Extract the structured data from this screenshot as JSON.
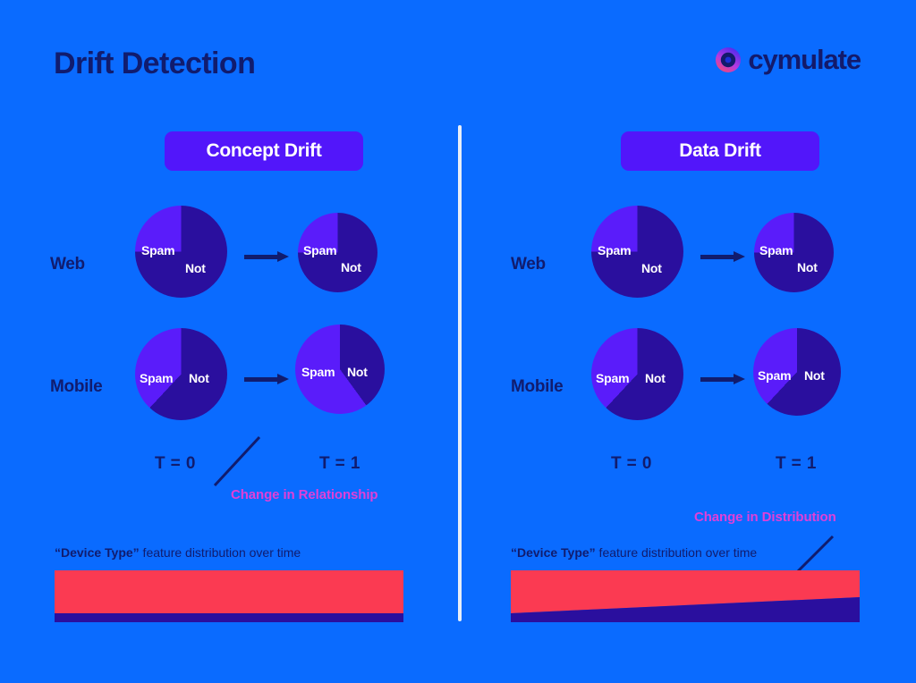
{
  "header": {
    "title": "Drift Detection",
    "logo_text": "cymulate",
    "logo_icon": "cymulate-ring-icon"
  },
  "colors": {
    "background": "#0a6bff",
    "navy": "#111c6e",
    "pill": "#5216fa",
    "pie_spam": "#5a1cfa",
    "pie_not": "#2a0f9e",
    "annotation": "#e040d8",
    "bar_top": "#fb3a52",
    "bar_bottom": "#2a0f9e",
    "divider": "#e8eef8"
  },
  "panels": [
    {
      "id": "concept-drift",
      "pill_label": "Concept Drift",
      "rows": [
        {
          "label": "Web",
          "pies": [
            {
              "t": "T = 0",
              "spam_pct": 25,
              "not_pct": 75,
              "spam_label": "Spam",
              "not_label": "Not"
            },
            {
              "t": "T = 1",
              "spam_pct": 25,
              "not_pct": 75,
              "spam_label": "Spam",
              "not_label": "Not"
            }
          ]
        },
        {
          "label": "Mobile",
          "pies": [
            {
              "t": "T = 0",
              "spam_pct": 38,
              "not_pct": 62,
              "spam_label": "Spam",
              "not_label": "Not"
            },
            {
              "t": "T = 1",
              "spam_pct": 60,
              "not_pct": 40,
              "spam_label": "Spam",
              "not_label": "Not"
            }
          ]
        }
      ],
      "annotation": "Change in Relationship",
      "dist_caption_quoted": "“Device Type”",
      "dist_caption_rest": " feature distribution over time",
      "dist_bar": {
        "type": "stable",
        "bottom_pct_start": 15,
        "bottom_pct_end": 15
      }
    },
    {
      "id": "data-drift",
      "pill_label": "Data Drift",
      "rows": [
        {
          "label": "Web",
          "pies": [
            {
              "t": "T = 0",
              "spam_pct": 25,
              "not_pct": 75,
              "spam_label": "Spam",
              "not_label": "Not"
            },
            {
              "t": "T = 1",
              "spam_pct": 25,
              "not_pct": 75,
              "spam_label": "Spam",
              "not_label": "Not"
            }
          ]
        },
        {
          "label": "Mobile",
          "pies": [
            {
              "t": "T = 0",
              "spam_pct": 38,
              "not_pct": 62,
              "spam_label": "Spam",
              "not_label": "Not"
            },
            {
              "t": "T = 1",
              "spam_pct": 38,
              "not_pct": 62,
              "spam_label": "Spam",
              "not_label": "Not"
            }
          ]
        }
      ],
      "annotation": "Change in Distribution",
      "dist_caption_quoted": "“Device Type”",
      "dist_caption_rest": " feature distribution over time",
      "dist_bar": {
        "type": "drifting",
        "bottom_pct_start": 15,
        "bottom_pct_end": 48
      }
    }
  ],
  "chart_data": {
    "type": "pie",
    "title": "Drift Detection",
    "charts": [
      {
        "panel": "Concept Drift",
        "segment": "Web",
        "time": "T = 0",
        "categories": [
          "Spam",
          "Not"
        ],
        "values": [
          25,
          75
        ]
      },
      {
        "panel": "Concept Drift",
        "segment": "Web",
        "time": "T = 1",
        "categories": [
          "Spam",
          "Not"
        ],
        "values": [
          25,
          75
        ]
      },
      {
        "panel": "Concept Drift",
        "segment": "Mobile",
        "time": "T = 0",
        "categories": [
          "Spam",
          "Not"
        ],
        "values": [
          38,
          62
        ]
      },
      {
        "panel": "Concept Drift",
        "segment": "Mobile",
        "time": "T = 1",
        "categories": [
          "Spam",
          "Not"
        ],
        "values": [
          60,
          40
        ]
      },
      {
        "panel": "Data Drift",
        "segment": "Web",
        "time": "T = 0",
        "categories": [
          "Spam",
          "Not"
        ],
        "values": [
          25,
          75
        ]
      },
      {
        "panel": "Data Drift",
        "segment": "Web",
        "time": "T = 1",
        "categories": [
          "Spam",
          "Not"
        ],
        "values": [
          25,
          75
        ]
      },
      {
        "panel": "Data Drift",
        "segment": "Mobile",
        "time": "T = 0",
        "categories": [
          "Spam",
          "Not"
        ],
        "values": [
          38,
          62
        ]
      },
      {
        "panel": "Data Drift",
        "segment": "Mobile",
        "time": "T = 1",
        "categories": [
          "Spam",
          "Not"
        ],
        "values": [
          38,
          62
        ]
      }
    ],
    "area_charts": [
      {
        "panel": "Concept Drift",
        "type": "area",
        "title": "“Device Type” feature distribution over time",
        "xlabel": "time",
        "series": [
          {
            "name": "Web",
            "values": [
              85,
              85
            ]
          },
          {
            "name": "Mobile",
            "values": [
              15,
              15
            ]
          }
        ],
        "ylim": [
          0,
          100
        ]
      },
      {
        "panel": "Data Drift",
        "type": "area",
        "title": "“Device Type” feature distribution over time",
        "xlabel": "time",
        "series": [
          {
            "name": "Web",
            "values": [
              85,
              52
            ]
          },
          {
            "name": "Mobile",
            "values": [
              15,
              48
            ]
          }
        ],
        "ylim": [
          0,
          100
        ]
      }
    ]
  }
}
